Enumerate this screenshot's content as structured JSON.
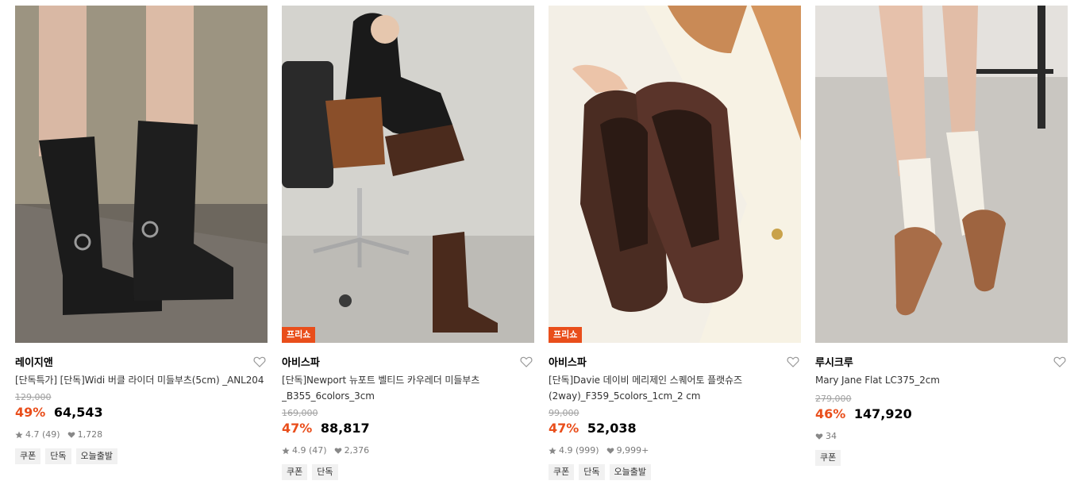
{
  "products": [
    {
      "brand": "레이지앤",
      "title": "[단독특가] [단독]Widi 버클 라이더 미들부츠(5cm) _ANL204",
      "original_price": "129,000",
      "discount": "49%",
      "price": "64,543",
      "rating": "4.7",
      "review_count": "(49)",
      "likes": "1,728",
      "tags": [
        "쿠폰",
        "단독",
        "오늘출발"
      ],
      "badge": ""
    },
    {
      "brand": "아비스파",
      "title": "[단독]Newport 뉴포트 벨티드 카우레더 미들부츠 _B355_6colors_3cm",
      "original_price": "169,000",
      "discount": "47%",
      "price": "88,817",
      "rating": "4.9",
      "review_count": "(47)",
      "likes": "2,376",
      "tags": [
        "쿠폰",
        "단독"
      ],
      "badge": "프리쇼"
    },
    {
      "brand": "아비스파",
      "title": "[단독]Davie 데이비 메리제인 스퀘어토 플랫슈즈(2way)_F359_5colors_1cm_2 cm",
      "original_price": "99,000",
      "discount": "47%",
      "price": "52,038",
      "rating": "4.9",
      "review_count": "(999)",
      "likes": "9,999+",
      "tags": [
        "쿠폰",
        "단독",
        "오늘출발"
      ],
      "badge": "프리쇼"
    },
    {
      "brand": "루시크루",
      "title": "Mary Jane Flat LC375_2cm",
      "original_price": "279,000",
      "discount": "46%",
      "price": "147,920",
      "rating": "",
      "review_count": "",
      "likes": "34",
      "tags": [
        "쿠폰"
      ],
      "badge": ""
    }
  ],
  "icons": {
    "heart": "heart-outline-icon",
    "star": "star-icon",
    "like": "heart-filled-icon"
  },
  "colors": {
    "accent": "#e94e1b",
    "muted": "#a0a0a0",
    "tag_bg": "#f1f1f1"
  }
}
